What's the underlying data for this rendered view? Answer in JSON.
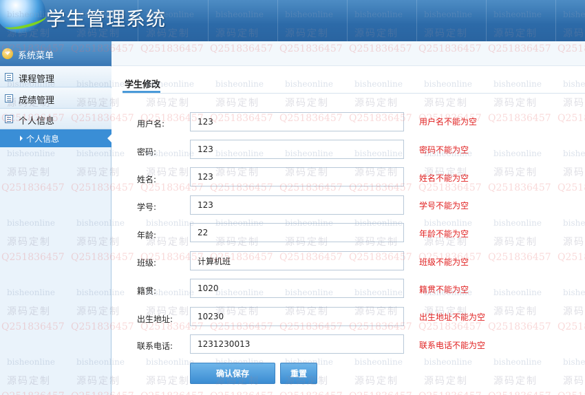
{
  "app": {
    "title": "学生管理系统"
  },
  "sidebar": {
    "menu_header": "系统菜单",
    "items": [
      {
        "label": "课程管理"
      },
      {
        "label": "成绩管理"
      },
      {
        "label": "个人信息"
      }
    ],
    "sub_item": {
      "label": "个人信息"
    }
  },
  "main": {
    "tab": "学生修改",
    "fields": [
      {
        "label": "用户名:",
        "value": "123",
        "error": "用户名不能为空"
      },
      {
        "label": "密码:",
        "value": "123",
        "error": "密码不能为空"
      },
      {
        "label": "姓名:",
        "value": "123",
        "error": "姓名不能为空"
      },
      {
        "label": "学号:",
        "value": "123",
        "error": "学号不能为空"
      },
      {
        "label": "年龄:",
        "value": "22",
        "error": "年龄不能为空"
      },
      {
        "label": "班级:",
        "value": "计算机班",
        "error": "班级不能为空"
      },
      {
        "label": "籍贯:",
        "value": "1020",
        "error": "籍贯不能为空"
      },
      {
        "label": "出生地址:",
        "value": "10230",
        "error": "出生地址不能为空"
      },
      {
        "label": "联系电话:",
        "value": "1231230013",
        "error": "联系电话不能为空"
      }
    ],
    "buttons": {
      "save": "确认保存",
      "reset": "重置"
    }
  },
  "watermark": {
    "site": "bisheonline",
    "custom": "源码定制",
    "qq": "Q2518364​57"
  },
  "colors": {
    "accent": "#3a8ed6",
    "error": "#e02020",
    "header": "#2c6aa8"
  }
}
